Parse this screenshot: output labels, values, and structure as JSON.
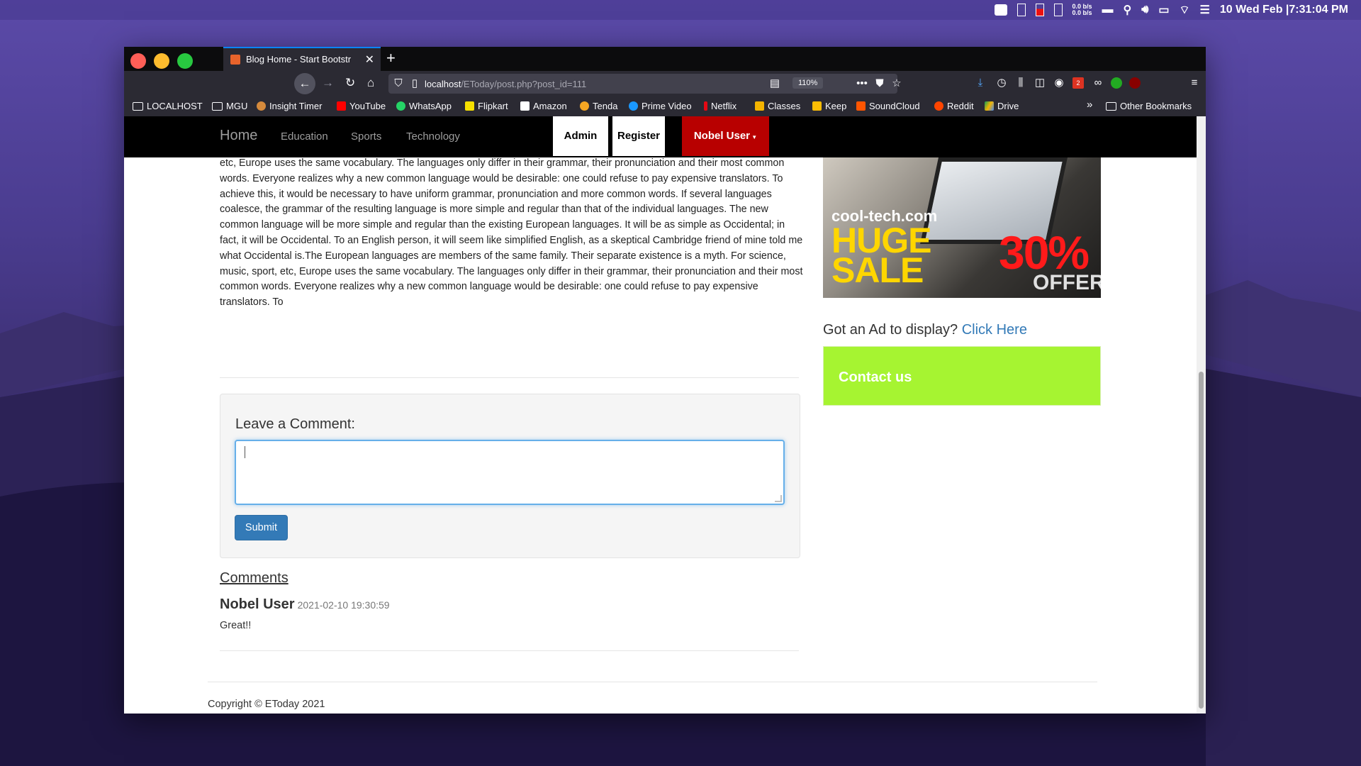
{
  "menubar": {
    "net_up": "0.0 b/s",
    "net_down": "0.0 b/s",
    "clock": "10 Wed Feb |7:31:04 PM"
  },
  "browser": {
    "tab_title": "Blog Home - Start Bootstr",
    "url_host": "localhost",
    "url_path": "/EToday/post.php?post_id=111",
    "zoom": "110%",
    "badge_count": "2",
    "bookmarks": [
      "LOCALHOST",
      "MGU",
      "Insight Timer",
      "YouTube",
      "WhatsApp",
      "Flipkart",
      "Amazon",
      "Tenda",
      "Prime Video",
      "Netflix",
      "Classes",
      "Keep",
      "SoundCloud",
      "Reddit",
      "Drive"
    ],
    "other_bookmarks": "Other Bookmarks"
  },
  "site": {
    "brand": "Home",
    "nav": [
      "Education",
      "Sports",
      "Technology"
    ],
    "admin": "Admin",
    "register": "Register",
    "user": "Nobel User"
  },
  "post": {
    "text": "etc, Europe uses the same vocabulary. The languages only differ in their grammar, their pronunciation and their most common words. Everyone realizes why a new common language would be desirable: one could refuse to pay expensive translators. To achieve this, it would be necessary to have uniform grammar, pronunciation and more common words. If several languages coalesce, the grammar of the resulting language is more simple and regular than that of the individual languages. The new common language will be more simple and regular than the existing European languages. It will be as simple as Occidental; in fact, it will be Occidental. To an English person, it will seem like simplified English, as a skeptical Cambridge friend of mine told me what Occidental is.The European languages are members of the same family. Their separate existence is a myth. For science, music, sport, etc, Europe uses the same vocabulary. The languages only differ in their grammar, their pronunciation and their most common words. Everyone realizes why a new common language would be desirable: one could refuse to pay expensive translators. To"
  },
  "comment_form": {
    "label": "Leave a Comment:",
    "submit": "Submit"
  },
  "comments": {
    "heading": "Comments",
    "items": [
      {
        "author": "Nobel User",
        "time": "2021-02-10 19:30:59",
        "text": "Great!!"
      }
    ]
  },
  "sidebar": {
    "ad_site": "cool-tech.com",
    "ad_huge": "HUGE",
    "ad_sale": "SALE",
    "ad_pct": "30%",
    "ad_offer": "OFFER",
    "got_ad": "Got an Ad to display?",
    "click_here": "Click Here",
    "contact": "Contact us"
  },
  "footer": {
    "copyright": "Copyright © EToday 2021"
  },
  "colors": {
    "accent": "#337ab7",
    "nav_red": "#b80000",
    "contact_green": "#a6f431"
  }
}
